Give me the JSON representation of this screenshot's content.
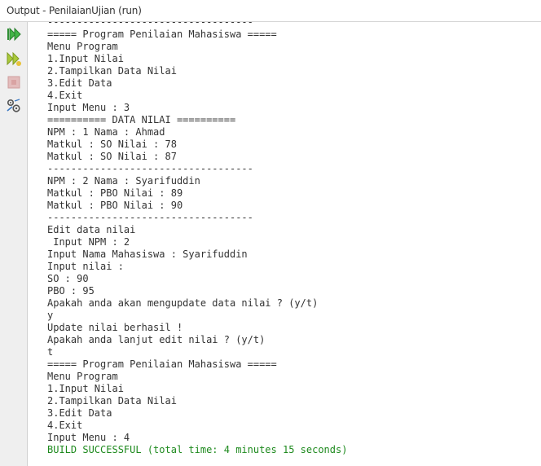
{
  "window": {
    "title": "Output - PenilaianUjian (run)"
  },
  "toolbar": [
    {
      "icon": "rerun-icon",
      "label": "Re-run"
    },
    {
      "icon": "rerun-with-params-icon",
      "label": "Re-run with parameters"
    },
    {
      "icon": "stop-icon",
      "label": "Stop"
    },
    {
      "icon": "settings-icon",
      "label": "Settings"
    }
  ],
  "colors": {
    "text": "#333333",
    "success": "#1e8a1e",
    "rerun_green": "#35a83a",
    "sidebar_bg": "#efefef"
  },
  "console": {
    "lines": [
      "-----------------------------------",
      "===== Program Penilaian Mahasiswa =====",
      "Menu Program",
      "1.Input Nilai",
      "2.Tampilkan Data Nilai",
      "3.Edit Data",
      "4.Exit",
      "Input Menu : 3",
      "========== DATA NILAI ==========",
      "NPM : 1 Nama : Ahmad",
      "Matkul : SO Nilai : 78",
      "Matkul : SO Nilai : 87",
      "-----------------------------------",
      "NPM : 2 Nama : Syarifuddin",
      "Matkul : PBO Nilai : 89",
      "Matkul : PBO Nilai : 90",
      "-----------------------------------",
      "Edit data nilai",
      " Input NPM : 2",
      "Input Nama Mahasiswa : Syarifuddin",
      "Input nilai :",
      "SO : 90",
      "PBO : 95",
      "Apakah anda akan mengupdate data nilai ? (y/t)",
      "y",
      "Update nilai berhasil !",
      "Apakah anda lanjut edit nilai ? (y/t)",
      "t",
      "===== Program Penilaian Mahasiswa =====",
      "Menu Program",
      "1.Input Nilai",
      "2.Tampilkan Data Nilai",
      "3.Edit Data",
      "4.Exit",
      "Input Menu : 4"
    ],
    "build_result": "BUILD SUCCESSFUL (total time: 4 minutes 15 seconds)"
  }
}
